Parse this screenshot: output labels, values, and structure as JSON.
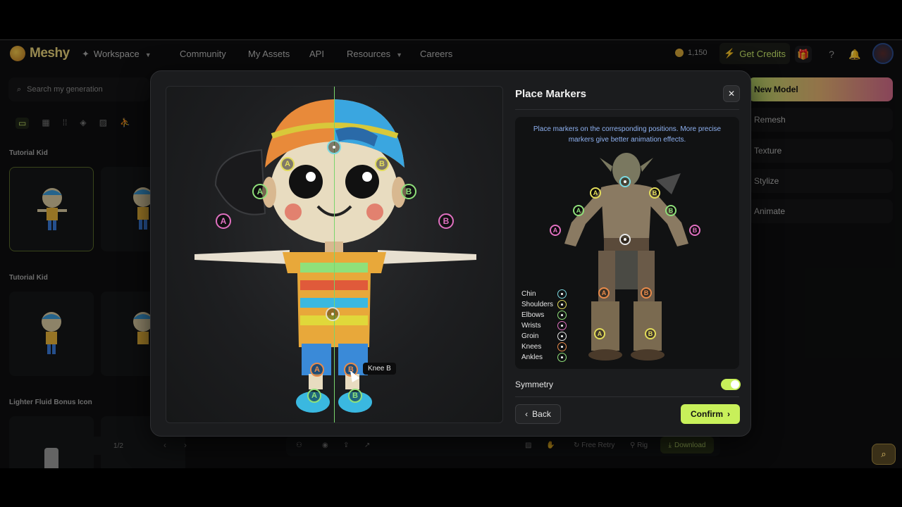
{
  "app": {
    "logo_text": "Meshy",
    "nav": {
      "workspace": "Workspace",
      "community": "Community",
      "my_assets": "My Assets",
      "api": "API",
      "resources": "Resources",
      "careers": "Careers"
    },
    "credits": "1,150",
    "get_credits": "Get Credits"
  },
  "sidebar": {
    "search_placeholder": "Search my generation",
    "sections": [
      "Tutorial Kid",
      "Tutorial Kid",
      "Lighter Fluid Bonus Icon"
    ],
    "pager": "1/2"
  },
  "tools": {
    "items": [
      "New Model",
      "Remesh",
      "Texture",
      "Stylize",
      "Animate"
    ]
  },
  "bottom_bar": {
    "free_retry": "Free Retry",
    "rig": "Rig",
    "download": "Download"
  },
  "modal": {
    "title": "Place Markers",
    "hint": "Place markers on the corresponding positions. More precise markers give better animation effects.",
    "legend": [
      {
        "label": "Chin",
        "color": "#7ad8e0"
      },
      {
        "label": "Shoulders",
        "color": "#e2dc5a"
      },
      {
        "label": "Elbows",
        "color": "#8fe07a"
      },
      {
        "label": "Wrists",
        "color": "#e070c0"
      },
      {
        "label": "Groin",
        "color": "#e6e6e6"
      },
      {
        "label": "Knees",
        "color": "#e88a4a"
      },
      {
        "label": "Ankles",
        "color": "#8fe07a"
      }
    ],
    "tooltip": "Knee B",
    "symmetry_label": "Symmetry",
    "symmetry_on": true,
    "back_label": "Back",
    "confirm_label": "Confirm",
    "marker_a": "A",
    "marker_b": "B"
  },
  "colors": {
    "accent": "#c8f05a",
    "modal_bg": "#1b1c1e",
    "hint_text": "#8fb2f2"
  }
}
